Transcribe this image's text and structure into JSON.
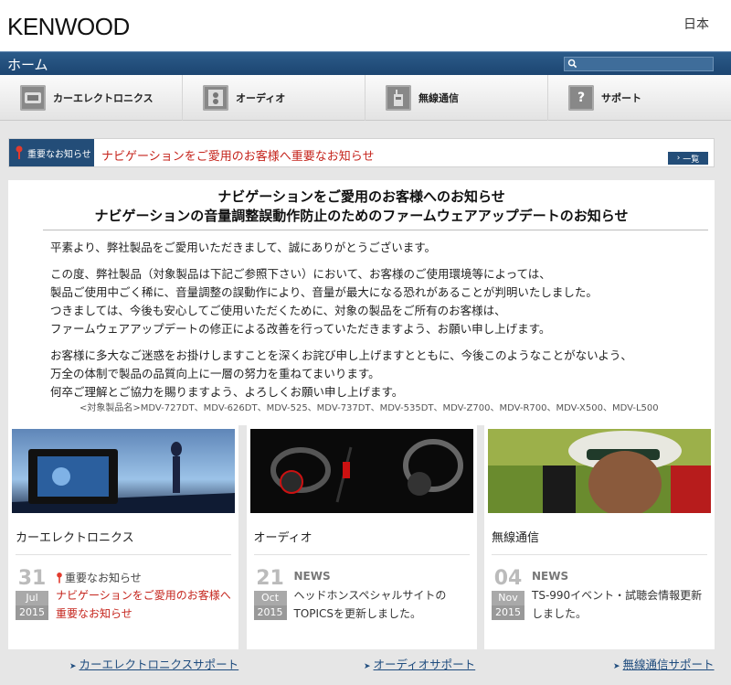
{
  "header": {
    "logo": "KENWOOD",
    "region": "日本"
  },
  "nav": {
    "home": "ホーム",
    "search_placeholder": ""
  },
  "categories": [
    {
      "label": "カーエレクトロニクス",
      "icon": "car-electronics-icon"
    },
    {
      "label": "オーディオ",
      "icon": "audio-speaker-icon"
    },
    {
      "label": "無線通信",
      "icon": "radio-communication-icon"
    },
    {
      "label": "サポート",
      "icon": "support-question-icon"
    }
  ],
  "notice": {
    "tag": "重要なお知らせ",
    "text": "ナビゲーションをご愛用のお客様へ重要なお知らせ",
    "list_button": "一覧"
  },
  "announcement": {
    "title_line1": "ナビゲーションをご愛用のお客様へのお知らせ",
    "title_line2": "ナビゲーションの音量調整誤動作防止のためのファームウェアアップデートのお知らせ",
    "para1": "平素より、弊社製品をご愛用いただきまして、誠にありがとうございます。",
    "para2_l1": "この度、弊社製品（対象製品は下記ご参照下さい）において、お客様のご使用環境等によっては、",
    "para2_l2": "製品ご使用中ごく稀に、音量調整の誤動作により、音量が最大になる恐れがあることが判明いたしました。",
    "para2_l3": "つきましては、今後も安心してご使用いただくために、対象の製品をご所有のお客様は、",
    "para2_l4": "ファームウェアアップデートの修正による改善を行っていただきますよう、お願い申し上げます。",
    "para3_l1": "お客様に多大なご迷惑をお掛けしますことを深くお詫び申し上げますとともに、今後このようなことがないよう、",
    "para3_l2": "万全の体制で製品の品質向上に一層の努力を重ねてまいります。",
    "para3_l3": "何卒ご理解とご協力を賜りますよう、よろしくお願い申し上げます。",
    "products": "<対象製品名>MDV-727DT、MDV-626DT、MDV-525、MDV-737DT、MDV-535DT、MDV-Z700、MDV-R700、MDV-X500、MDV-L500"
  },
  "cards": [
    {
      "title": "カーエレクトロニクス",
      "day": "31",
      "month": "Jul",
      "year": "2015",
      "label": "重要なお知らせ",
      "text": "ナビゲーションをご愛用のお客様へ重要なお知らせ"
    },
    {
      "title": "オーディオ",
      "day": "21",
      "month": "Oct",
      "year": "2015",
      "label": "NEWS",
      "text": "ヘッドホンスペシャルサイトのTOPICSを更新しました。"
    },
    {
      "title": "無線通信",
      "day": "04",
      "month": "Nov",
      "year": "2015",
      "label": "NEWS",
      "text": "TS-990イベント・試聴会情報更新しました。"
    }
  ],
  "footer": {
    "link1": "カーエレクトロニクスサポート",
    "link2": "オーディオサポート",
    "link3": "無線通信サポート"
  },
  "colors": {
    "brand_blue": "#234d78",
    "alert_red": "#c5241c",
    "link_blue": "#1f4c7e"
  }
}
